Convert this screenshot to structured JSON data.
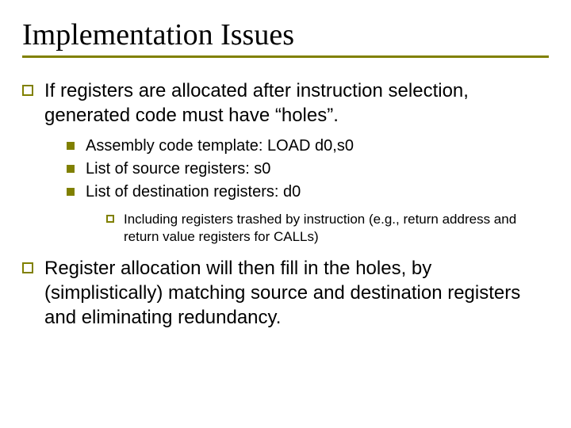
{
  "title": "Implementation Issues",
  "bullets": {
    "p1": "If registers are allocated after instruction selection, generated code must have “holes”.",
    "p1_sub": [
      "Assembly code template: LOAD d0,s0",
      "List of source registers: s0",
      "List of destination registers: d0"
    ],
    "p1_sub_sub": "Including registers trashed by instruction (e.g., return address and return value registers for CALLs)",
    "p2": "Register allocation will then fill in the holes, by (simplistically) matching source and destination registers and eliminating redundancy."
  }
}
